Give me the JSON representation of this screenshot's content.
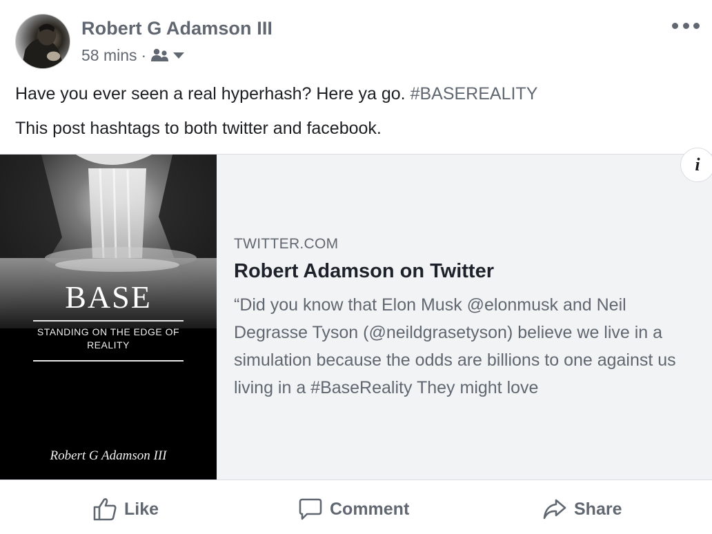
{
  "post": {
    "author": "Robert G Adamson III",
    "timestamp": "58 mins",
    "separator": "·",
    "audience_icon": "friends-icon",
    "more_icon": "more-dots-icon",
    "text_line1": "Have you ever seen a real hyperhash? Here ya go. ",
    "hashtag": "#BASEREALITY",
    "text_line2": "This post hashtags to both twitter and facebook."
  },
  "link_preview": {
    "info_label": "i",
    "domain": "TWITTER.COM",
    "title": "Robert Adamson on Twitter",
    "description": "“Did you know that Elon Musk @elonmusk and Neil Degrasse Tyson (@neildgrasetyson) believe we live in a simulation because the odds are billions to one against us living in a #BaseReality They might love",
    "cover": {
      "title": "BASE",
      "subtitle": "STANDING ON THE EDGE OF REALITY",
      "author": "Robert G Adamson III"
    }
  },
  "actions": {
    "like": "Like",
    "comment": "Comment",
    "share": "Share"
  },
  "colors": {
    "meta_text": "#616770",
    "card_background": "#f2f3f5",
    "body_text": "#1c1e21"
  }
}
